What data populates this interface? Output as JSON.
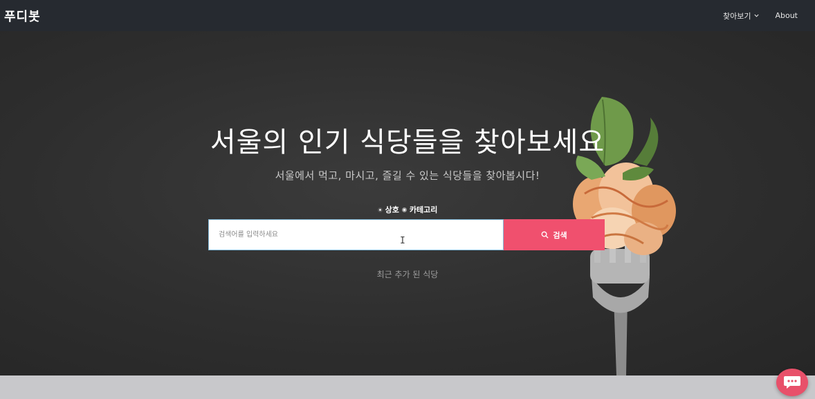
{
  "navbar": {
    "brand": "푸디봇",
    "menu_explore": "찾아보기",
    "menu_about": "About"
  },
  "hero": {
    "headline": "서울의 인기 식당들을 찾아보세요",
    "subline": "서울에서 먹고, 마시고, 즐길 수 있는 식당들을 찾아봅시다!",
    "search_options": [
      {
        "label": "상호",
        "checked": true
      },
      {
        "label": "카테고리",
        "checked": false
      }
    ],
    "search": {
      "placeholder": "검색어를 입력하세요",
      "button_label": "검색"
    },
    "recent_link": "최근 추가 된 식당"
  },
  "colors": {
    "navbar_bg": "#262a30",
    "accent": "#f0506e",
    "hero_bg": "#2e2e2e",
    "chat_button": "#e8506a"
  },
  "icons": {
    "explore_dropdown": "chevron-down-icon",
    "search_button": "search-icon",
    "chat": "chat-bubble-icon"
  }
}
